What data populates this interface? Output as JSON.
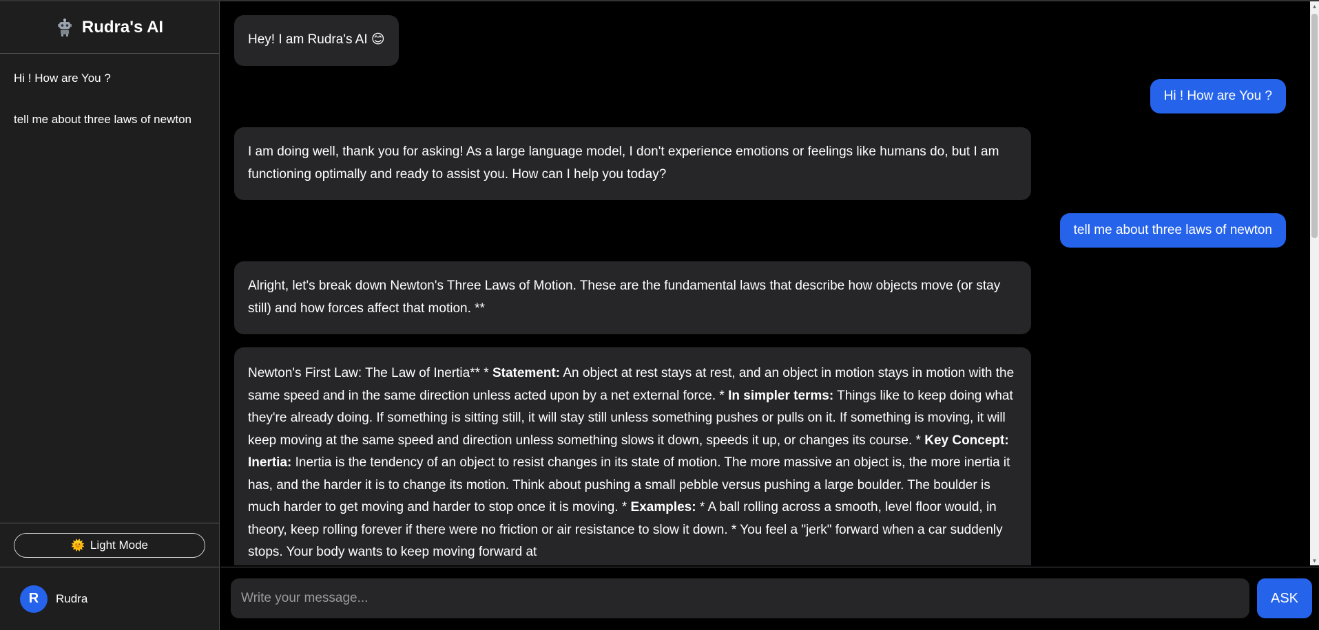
{
  "sidebar": {
    "brand_icon": "robot-icon",
    "title": "Rudra's AI",
    "history": [
      {
        "label": "Hi ! How are You ?"
      },
      {
        "label": "tell me about three laws of newton"
      }
    ],
    "theme_icon": "sun-icon",
    "theme_label": "Light Mode",
    "user": {
      "initial": "R",
      "name": "Rudra"
    }
  },
  "chat": {
    "messages": [
      {
        "role": "bot",
        "text": "Hey! I am Rudra's AI 😊"
      },
      {
        "role": "user",
        "text": "Hi ! How are You ?"
      },
      {
        "role": "bot",
        "text": "I am doing well, thank you for asking! As a large language model, I don't experience emotions or feelings like humans do, but I am functioning optimally and ready to assist you. How can I help you today?"
      },
      {
        "role": "user",
        "text": "tell me about three laws of newton"
      },
      {
        "role": "bot",
        "text": "Alright, let's break down Newton's Three Laws of Motion. These are the fundamental laws that describe how objects move (or stay still) and how forces affect that motion. **"
      }
    ],
    "long_message": {
      "p1": "Newton's First Law: The Law of Inertia** * ",
      "b1": "Statement:",
      "p2": " An object at rest stays at rest, and an object in motion stays in motion with the same speed and in the same direction unless acted upon by a net external force. * ",
      "b2": "In simpler terms:",
      "p3": " Things like to keep doing what they're already doing. If something is sitting still, it will stay still unless something pushes or pulls on it. If something is moving, it will keep moving at the same speed and direction unless something slows it down, speeds it up, or changes its course. * ",
      "b3": "Key Concept: Inertia:",
      "p4": " Inertia is the tendency of an object to resist changes in its state of motion. The more massive an object is, the more inertia it has, and the harder it is to change its motion. Think about pushing a small pebble versus pushing a large boulder. The boulder is much harder to get moving and harder to stop once it is moving. * ",
      "b4": "Examples:",
      "p5": " * A ball rolling across a smooth, level floor would, in theory, keep rolling forever if there were no friction or air resistance to slow it down. * You feel a \"jerk\" forward when a car suddenly stops. Your body wants to keep moving forward at"
    }
  },
  "composer": {
    "placeholder": "Write your message...",
    "ask_label": "ASK"
  },
  "colors": {
    "accent": "#2563eb",
    "sidebar_bg": "#1e1e1f",
    "bubble_bg": "#262628",
    "page_bg": "#000000"
  }
}
